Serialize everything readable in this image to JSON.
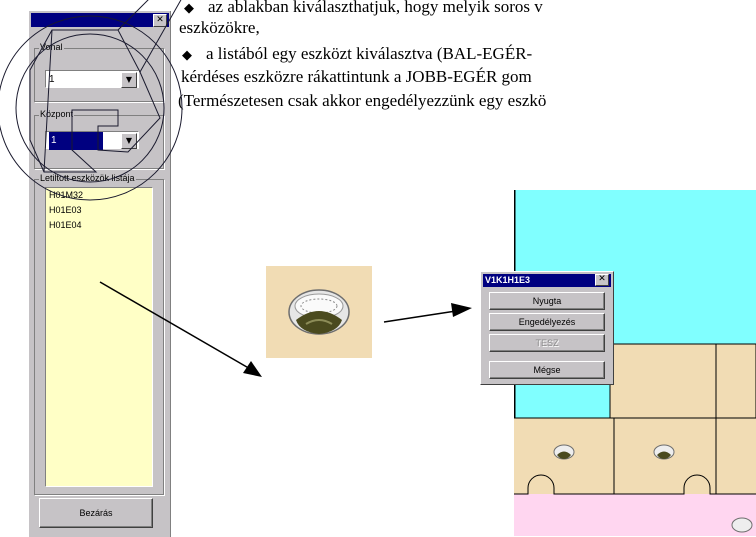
{
  "document_text": {
    "line1": "az ablakban kiválaszthatjuk, hogy melyik soros v",
    "line2": "eszközökre,",
    "line3": "a listából egy eszközt kiválasztva (BAL-EGÉR-",
    "line4": "kérdéses eszközre rákattintunk a JOBB-EGÉR gom",
    "line5": "(Természetesen csak akkor engedélyezzünk egy eszkö",
    "bullet": "◆"
  },
  "left_panel": {
    "close_glyph": "✕",
    "group_vonal": "Vonal",
    "vonal_value": "1",
    "group_kozpont": "Központ",
    "kozpont_value": "1",
    "group_list": "Letiltott eszközök listája",
    "list_items": [
      "H01M32",
      "H01E03",
      "H01E04"
    ],
    "button_bezaras": "Bezárás",
    "combo_arrow": "▼"
  },
  "popup": {
    "title": "V1K1H1E3",
    "close_glyph": "✕",
    "buttons": [
      "Nyugta",
      "Engedélyezés",
      "TESZ",
      "Mégse"
    ],
    "disabled_index": 2
  },
  "colors": {
    "panel_bg": "#c6c3c6",
    "listbox_bg": "#ffffc6",
    "plan_cyan": "#80ffff",
    "plan_beige": "#f1dcb4",
    "plan_pink": "#ffd6f0",
    "titlebar": "#000080"
  },
  "icons": [
    "smoke-detector-icon",
    "arrow-icon",
    "close-icon"
  ]
}
